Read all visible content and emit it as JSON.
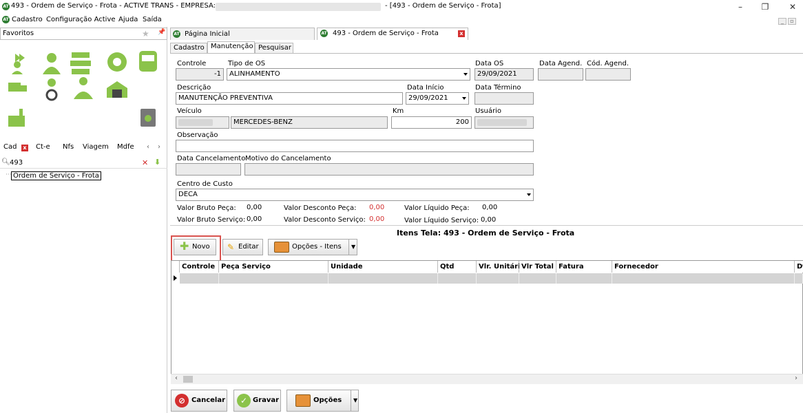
{
  "window": {
    "title_prefix": "493 - Ordem de Serviço - Frota - ACTIVE TRANS - EMPRESA:",
    "title_suffix": "- [493 - Ordem de Serviço - Frota]",
    "logo_text": "AT"
  },
  "menu": [
    "Cadastro",
    "Configuração Active",
    "Ajuda",
    "Saída"
  ],
  "sidebar": {
    "favorites_label": "Favoritos",
    "tabs": [
      "Cad",
      "Ct-e",
      "Nfs",
      "Viagem",
      "Mdfe"
    ],
    "search_value": "493",
    "tree_items": [
      "Ordem de Serviço - Frota"
    ],
    "icons": [
      "add-user-icon",
      "person-icon",
      "fleet-trucks-icon",
      "tire-star-icon",
      "bus-icon",
      "truck-icon",
      "driver-wheel-icon",
      "driver-car-icon",
      "garage-icon",
      "factory-icon",
      "recycle-bin-icon"
    ]
  },
  "doc_tabs": [
    {
      "label": "Página Inicial"
    },
    {
      "label": "493 - Ordem de Serviço - Frota"
    }
  ],
  "sub_tabs": [
    "Cadastro",
    "Manutenção",
    "Pesquisar"
  ],
  "form": {
    "controle_label": "Controle",
    "controle_value": "-1",
    "tipo_os_label": "Tipo de OS",
    "tipo_os_value": "ALINHAMENTO",
    "data_os_label": "Data OS",
    "data_os_value": "29/09/2021",
    "data_agend_label": "Data Agend.",
    "cod_agend_label": "Cód. Agend.",
    "descricao_label": "Descrição",
    "descricao_value": "MANUTENÇÃO PREVENTIVA",
    "data_inicio_label": "Data Início",
    "data_inicio_value": "29/09/2021",
    "data_termino_label": "Data Término",
    "veiculo_label": "Veículo",
    "veiculo_marca": "MERCEDES-BENZ",
    "km_label": "Km",
    "km_value": "200",
    "usuario_label": "Usuário",
    "observacao_label": "Observação",
    "data_cancel_label": "Data Cancelamento",
    "motivo_cancel_label": "Motivo do Cancelamento",
    "centro_custo_label": "Centro de Custo",
    "centro_custo_value": "DECA",
    "totals": {
      "bruto_peca_label": "Valor Bruto Peça:",
      "bruto_peca": "0,00",
      "bruto_servico_label": "Valor Bruto Serviço:",
      "bruto_servico": "0,00",
      "desc_peca_label": "Valor Desconto Peça:",
      "desc_peca": "0,00",
      "desc_servico_label": "Valor Desconto Serviço:",
      "desc_servico": "0,00",
      "liq_peca_label": "Valor Líquido Peça:",
      "liq_peca": "0,00",
      "liq_servico_label": "Valor Líquido Serviço:",
      "liq_servico": "0,00"
    }
  },
  "items": {
    "title": "Itens Tela:  493 - Ordem de Serviço - Frota",
    "btn_novo": "Novo",
    "btn_editar": "Editar",
    "btn_opcoes_itens": "Opções - Itens",
    "columns": [
      "Controle",
      "Peça Serviço",
      "Unidade",
      "Qtd",
      "Vlr. Unitário",
      "Vlr Total",
      "Fatura",
      "Fornecedor",
      "Dt"
    ]
  },
  "bottom": {
    "cancelar": "Cancelar",
    "gravar": "Gravar",
    "opcoes": "Opções"
  },
  "colors": {
    "accent_green": "#8bc34a",
    "highlight_red": "#d9534f",
    "value_red": "#d32f2f"
  }
}
